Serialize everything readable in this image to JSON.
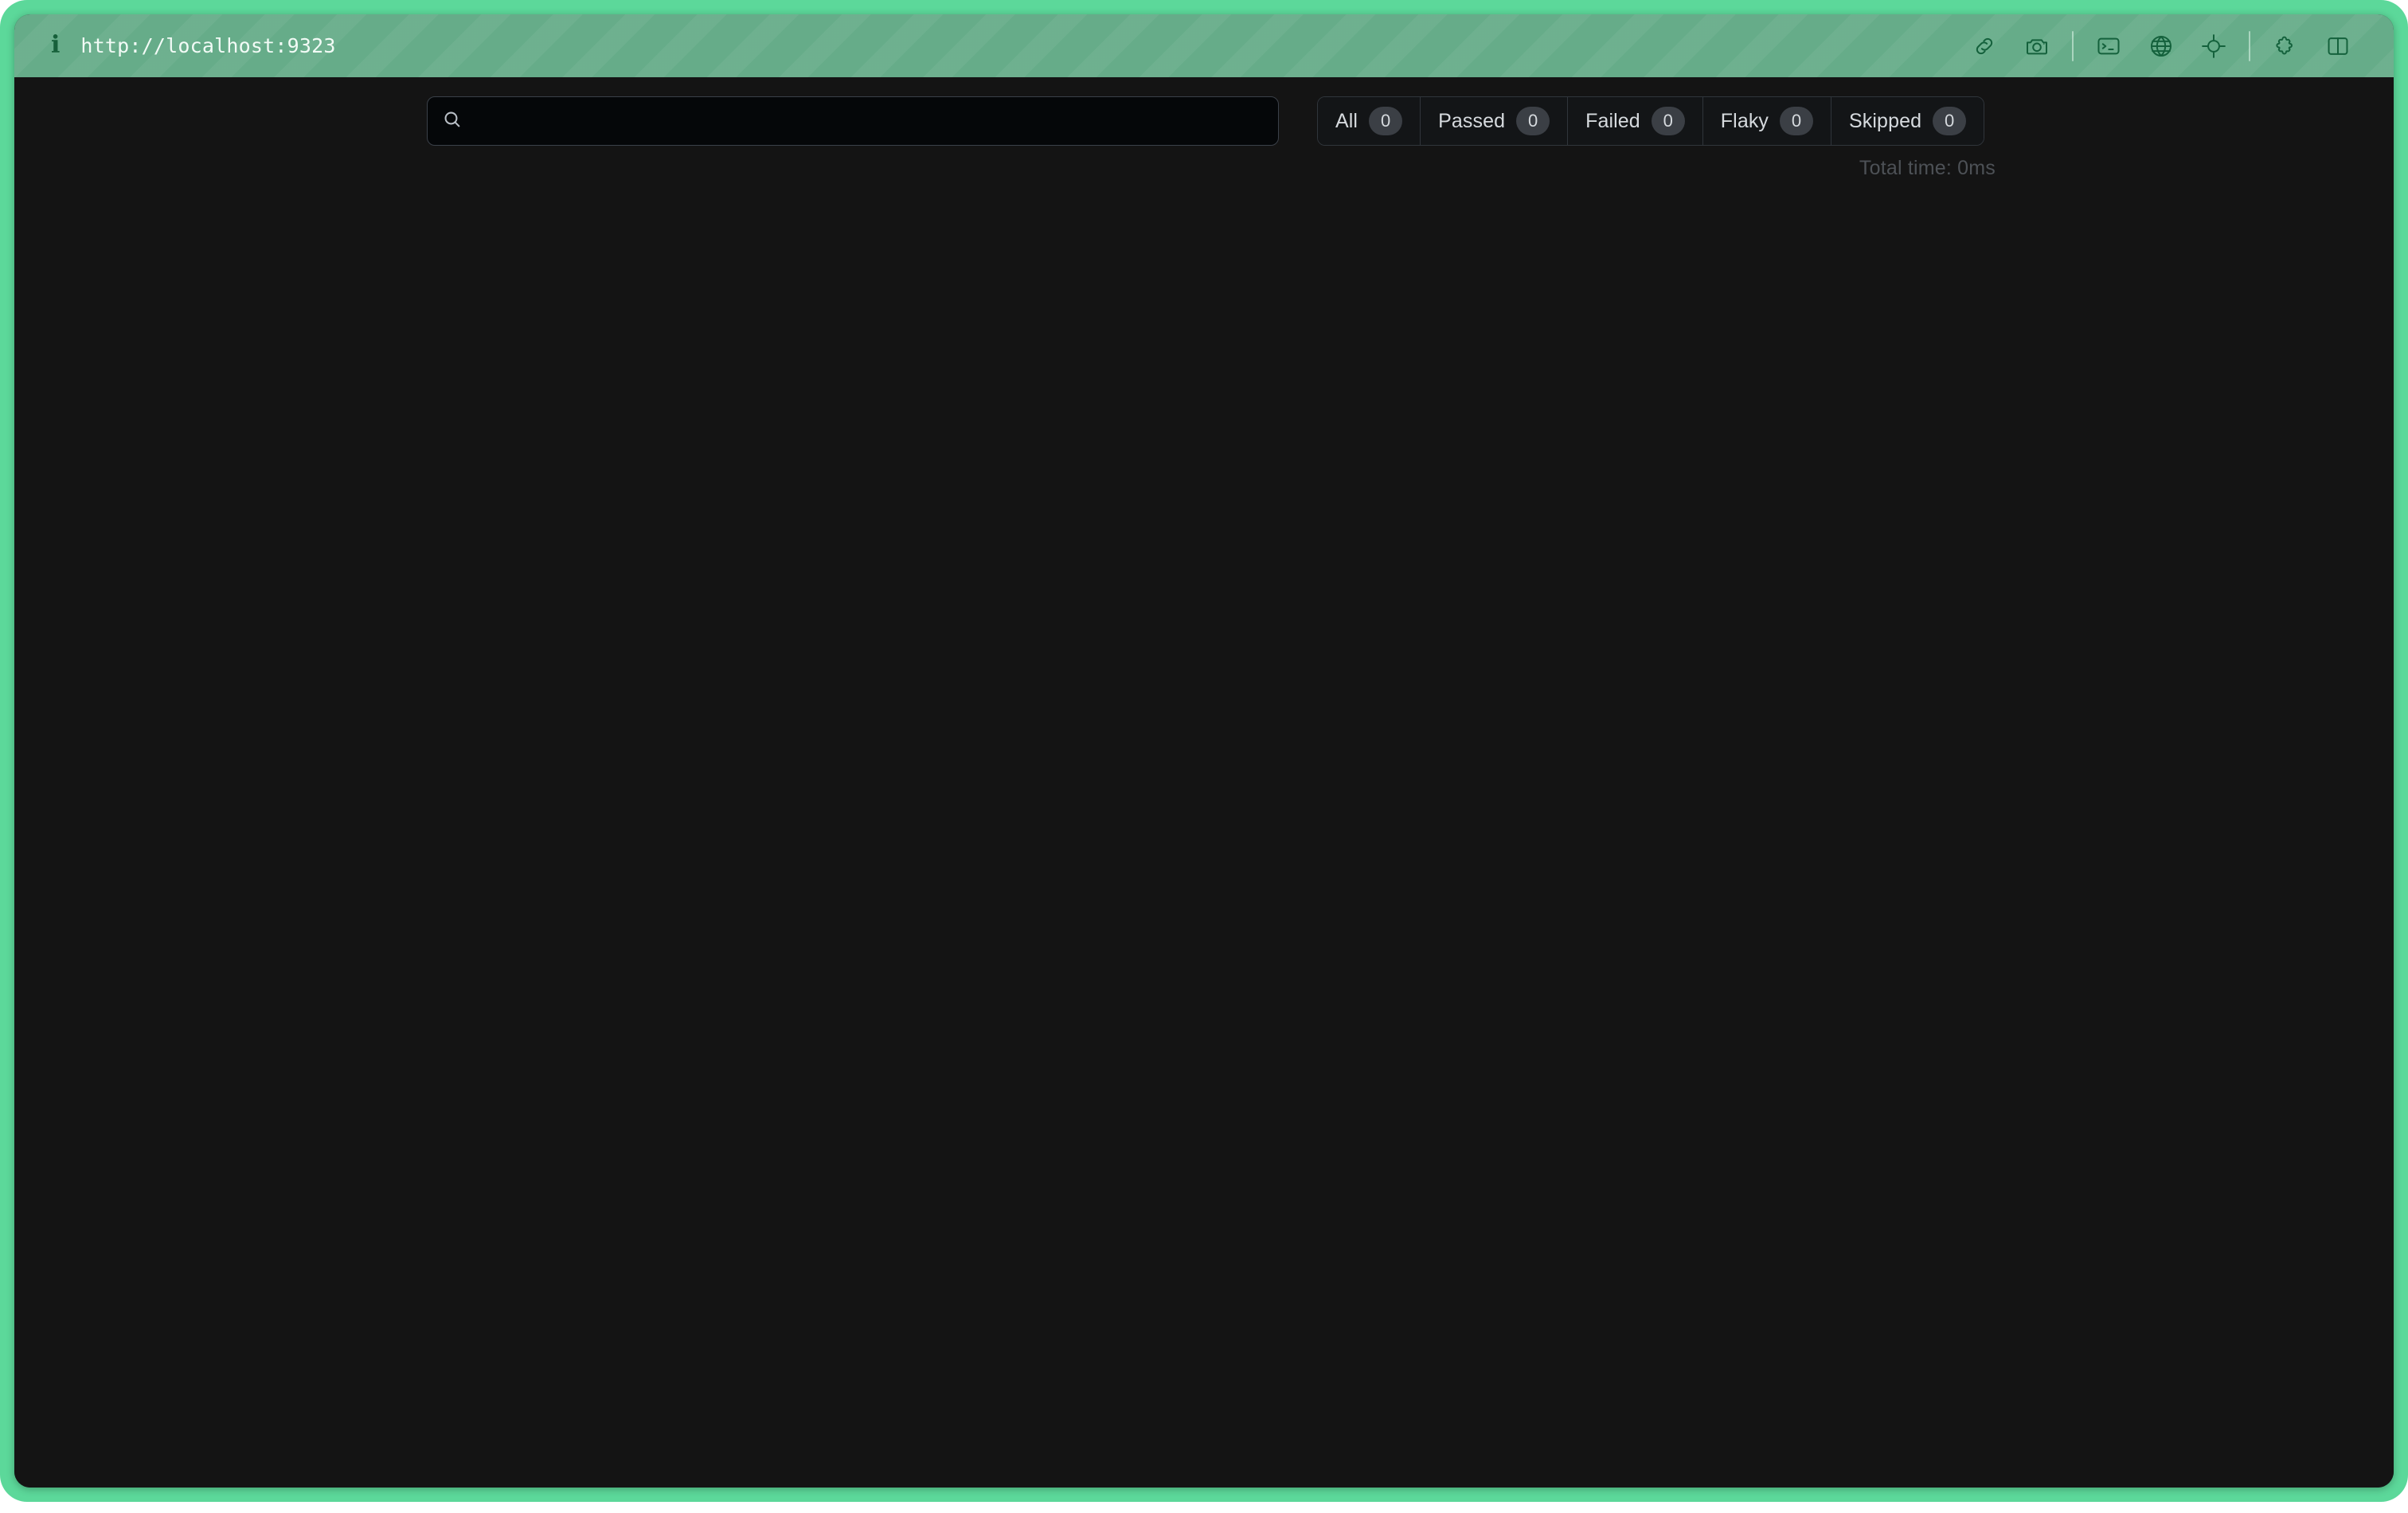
{
  "window": {
    "frame_color": "#5cd89a",
    "content_bg": "#141414"
  },
  "header": {
    "info_icon": "info-icon",
    "info_glyph": "i",
    "url": "http://localhost:9323",
    "actions": [
      {
        "name": "copy-link-icon",
        "title": "Copy link"
      },
      {
        "name": "screenshot-camera-icon",
        "title": "Screenshot"
      },
      {
        "name": "terminal-console-icon",
        "title": "Console"
      },
      {
        "name": "network-globe-icon",
        "title": "Network"
      },
      {
        "name": "inspect-target-icon",
        "title": "Inspect element"
      },
      {
        "name": "extension-puzzle-icon",
        "title": "Extensions"
      },
      {
        "name": "split-panel-icon",
        "title": "Toggle panel"
      }
    ]
  },
  "toolbar": {
    "search": {
      "icon": "search-icon",
      "value": "",
      "placeholder": ""
    },
    "filters": [
      {
        "label": "All",
        "count": "0",
        "name": "filter-tab-all",
        "active": true
      },
      {
        "label": "Passed",
        "count": "0",
        "name": "filter-tab-passed",
        "active": false
      },
      {
        "label": "Failed",
        "count": "0",
        "name": "filter-tab-failed",
        "active": false
      },
      {
        "label": "Flaky",
        "count": "0",
        "name": "filter-tab-flaky",
        "active": false
      },
      {
        "label": "Skipped",
        "count": "0",
        "name": "filter-tab-skipped",
        "active": false
      }
    ],
    "total_time": "Total time: 0ms"
  },
  "results": {
    "items": []
  }
}
